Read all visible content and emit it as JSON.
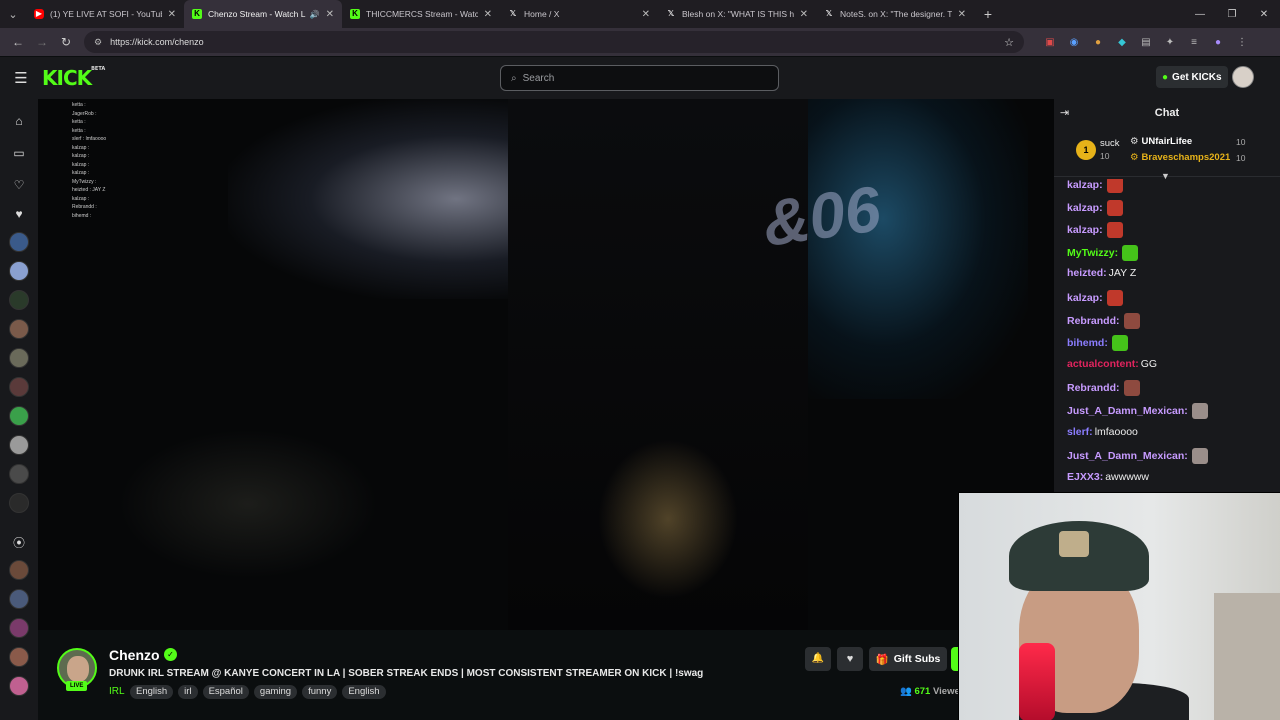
{
  "browser": {
    "tabs": [
      {
        "title": "(1) YE LIVE AT SOFI - YouTube",
        "icon": "youtube-icon",
        "color": "#ff0000",
        "active": false
      },
      {
        "title": "Chenzo Stream - Watch Live",
        "icon": "kick-icon",
        "color": "#53fc18",
        "active": true
      },
      {
        "title": "THICCMERCS Stream - Watch Li",
        "icon": "kick-icon",
        "color": "#53fc18",
        "active": false
      },
      {
        "title": "Home / X",
        "icon": "x-icon",
        "color": "#ffffff",
        "active": false
      },
      {
        "title": "Blesh on X: \"WHAT IS THIS http",
        "icon": "x-icon",
        "color": "#ffffff",
        "active": false
      },
      {
        "title": "NoteS. on X: \"The designer. The",
        "icon": "x-icon",
        "color": "#ffffff",
        "active": false
      }
    ],
    "url": "https://kick.com/chenzo"
  },
  "header": {
    "logo": "KICK",
    "logo_sup": "BETA",
    "search_placeholder": "Search",
    "get_kicks": "Get KICKs",
    "brand_color": "#53fc18"
  },
  "video": {
    "overlay_text": "&06",
    "overlay_chat": [
      "ketta :",
      "JagerRob :",
      "ketta :",
      "ketta :",
      "slerf : lmfaoooo",
      "kalzap :",
      "kalzap :",
      "kalzap :",
      "kalzap :",
      "MyTwizzy :",
      "heizted : JAY Z",
      "kalzap :",
      "Rebrandd :",
      "bihemd :"
    ]
  },
  "stream": {
    "name": "Chenzo",
    "live": "LIVE",
    "title": "DRUNK IRL STREAM @ KANYE CONCERT IN LA | SOBER STREAK ENDS | MOST CONSISTENT STREAMER ON KICK | !swag",
    "category": "IRL",
    "tags": [
      "English",
      "irl",
      "Español",
      "gaming",
      "funny",
      "English"
    ],
    "gift_subs": "Gift Subs",
    "viewers": "671",
    "viewers_label": "Viewe"
  },
  "chat": {
    "title": "Chat",
    "pinned": {
      "rank": "1",
      "left_name": "suck",
      "left_count": "10",
      "gifters": [
        {
          "name": "UNfairLifee",
          "count": "10",
          "color": "#ffffff"
        },
        {
          "name": "Braveschamps2021",
          "count": "10",
          "color": "#e6b219"
        }
      ]
    },
    "messages": [
      {
        "user": "kalzap:",
        "text": "",
        "color": "#c79bff",
        "emote": "#c0392b"
      },
      {
        "user": "kalzap:",
        "text": "",
        "color": "#c79bff",
        "emote": "#c0392b"
      },
      {
        "user": "kalzap:",
        "text": "",
        "color": "#c79bff",
        "emote": "#c0392b"
      },
      {
        "user": "MyTwizzy:",
        "text": "",
        "color": "#53fc18",
        "emote": "#45c21a"
      },
      {
        "user": "heizted:",
        "text": "JAY Z",
        "color": "#c79bff",
        "emote": ""
      },
      {
        "user": "kalzap:",
        "text": "",
        "color": "#c79bff",
        "emote": "#c0392b"
      },
      {
        "user": "Rebrandd:",
        "text": "",
        "color": "#c79bff",
        "emote": "#8e4a3f"
      },
      {
        "user": "bihemd:",
        "text": "",
        "color": "#8b7dff",
        "emote": "#45c21a"
      },
      {
        "user": "actualcontent:",
        "text": "GG",
        "color": "#e0245e",
        "emote": ""
      },
      {
        "user": "Rebrandd:",
        "text": "",
        "color": "#c79bff",
        "emote": "#8e4a3f"
      },
      {
        "user": "Just_A_Damn_Mexican:",
        "text": "",
        "color": "#c79bff",
        "emote": "#9a8e8a"
      },
      {
        "user": "slerf:",
        "text": "lmfaoooo",
        "color": "#8b7dff",
        "emote": ""
      },
      {
        "user": "Just_A_Damn_Mexican:",
        "text": "",
        "color": "#c79bff",
        "emote": "#9a8e8a"
      },
      {
        "user": "EJXX3:",
        "text": "awwwww",
        "color": "#c79bff",
        "emote": ""
      }
    ]
  }
}
